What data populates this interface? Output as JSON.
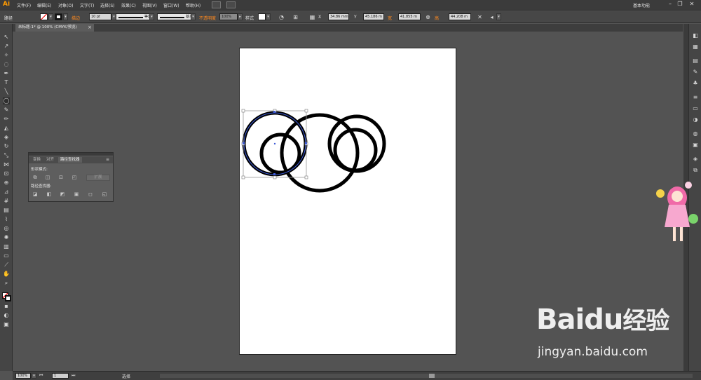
{
  "app": {
    "logo": "Ai",
    "workspace": "基本功能"
  },
  "menu": [
    "文件(F)",
    "编辑(E)",
    "对象(O)",
    "文字(T)",
    "选择(S)",
    "效果(C)",
    "视图(V)",
    "窗口(W)",
    "帮助(H)"
  ],
  "window_controls": [
    "–",
    "❐",
    "✕"
  ],
  "control_bar": {
    "selection_type": "路径",
    "stroke_label": "描边",
    "stroke_weight": "10 pt",
    "stroke_profile": "等比",
    "brush": "基本",
    "opacity_label": "不透明度",
    "opacity": "100%",
    "style_label": "样式",
    "x_label": "X",
    "x": "34.86 mm",
    "y_label": "Y",
    "y": "45.186 m",
    "w_label": "宽",
    "w": "41.855 m",
    "h_label": "高",
    "h": "44.208 m"
  },
  "document_tab": {
    "title": "未标题-1* @ 100% (CMYK/预览)",
    "close": "×"
  },
  "pathfinder": {
    "tabs": [
      "变换",
      "对齐",
      "路径查找器"
    ],
    "active_tab": 2,
    "menu_glyph": "≡",
    "shape_modes_label": "形状模式:",
    "expand_label": "扩展",
    "pathfinders_label": "路径查找器:"
  },
  "status_bar": {
    "zoom": "100%",
    "page": "1",
    "tool": "选择"
  },
  "watermark": {
    "brand": "Baidu",
    "brand_cn": "经验",
    "url": "jingyan.baidu.com"
  },
  "colors": {
    "accent_orange": "#ff8a1e",
    "selection_blue": "#3d5bd8",
    "panel_bg": "#5e5e5e",
    "workspace_bg": "#535353"
  }
}
